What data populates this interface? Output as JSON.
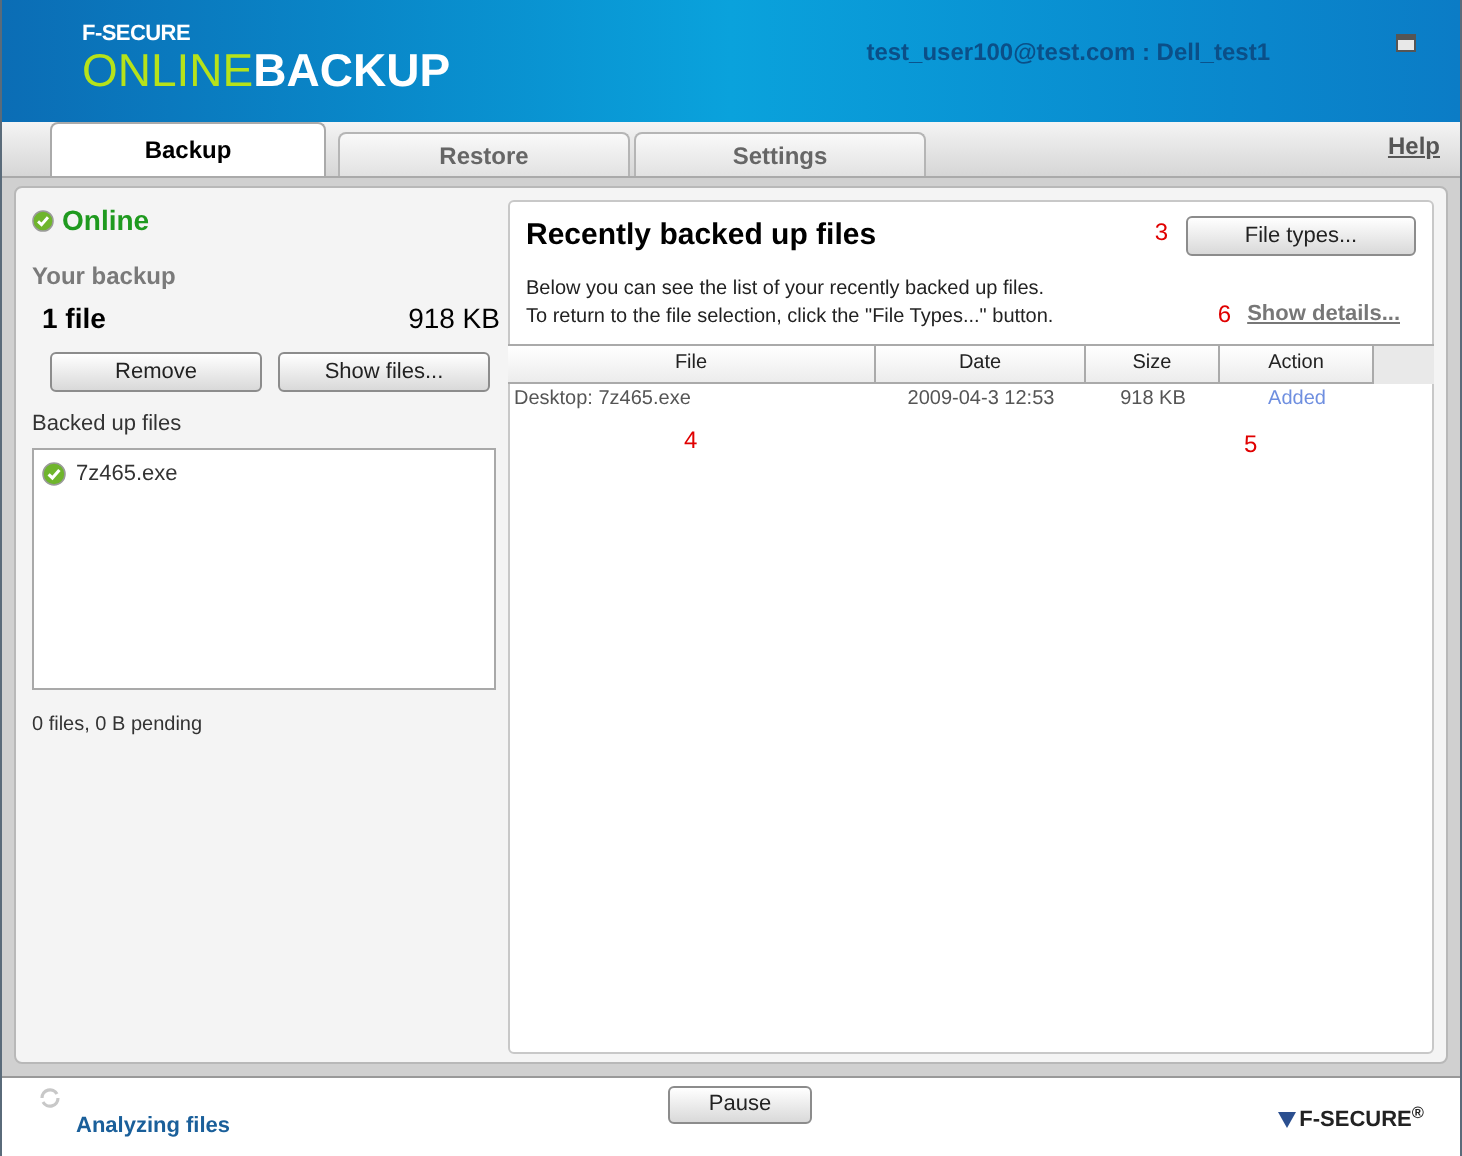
{
  "header": {
    "brand_top": "F-SECURE",
    "brand_light": "ONLINE",
    "brand_bold": "BACKUP",
    "account": "test_user100@test.com : Dell_test1"
  },
  "tabs": [
    {
      "label": "Backup",
      "selected": true
    },
    {
      "label": "Restore",
      "selected": false
    },
    {
      "label": "Settings",
      "selected": false
    }
  ],
  "help_link": "Help",
  "left": {
    "status": "Online",
    "your_backup": "Your backup",
    "count": "1 file",
    "size": "918 KB",
    "buttons": [
      "Remove",
      "Show files..."
    ],
    "list_title": "Backed up files",
    "files": [
      {
        "name": "7z465.exe"
      }
    ],
    "pending": "0 files, 0 B pending"
  },
  "right": {
    "title": "Recently backed up files",
    "file_types_button": "File types...",
    "description": [
      "Below you can see the list of your recently backed up files.",
      "To return to the file selection, click the \"File Types...\" button."
    ],
    "show_details": "Show details...",
    "table": {
      "columns": [
        "File",
        "Date",
        "Size",
        "Action"
      ],
      "rows": [
        [
          "Desktop: 7z465.exe",
          "2009-04-3 12:53",
          "918 KB",
          "Added"
        ]
      ]
    }
  },
  "annotations": {
    "file_types": "3",
    "show_details": "6",
    "file_column": "4",
    "action_column": "5"
  },
  "footer": {
    "status": "Analyzing files",
    "pause_button": "Pause",
    "logo": "F-SECURE$^{®}$"
  }
}
